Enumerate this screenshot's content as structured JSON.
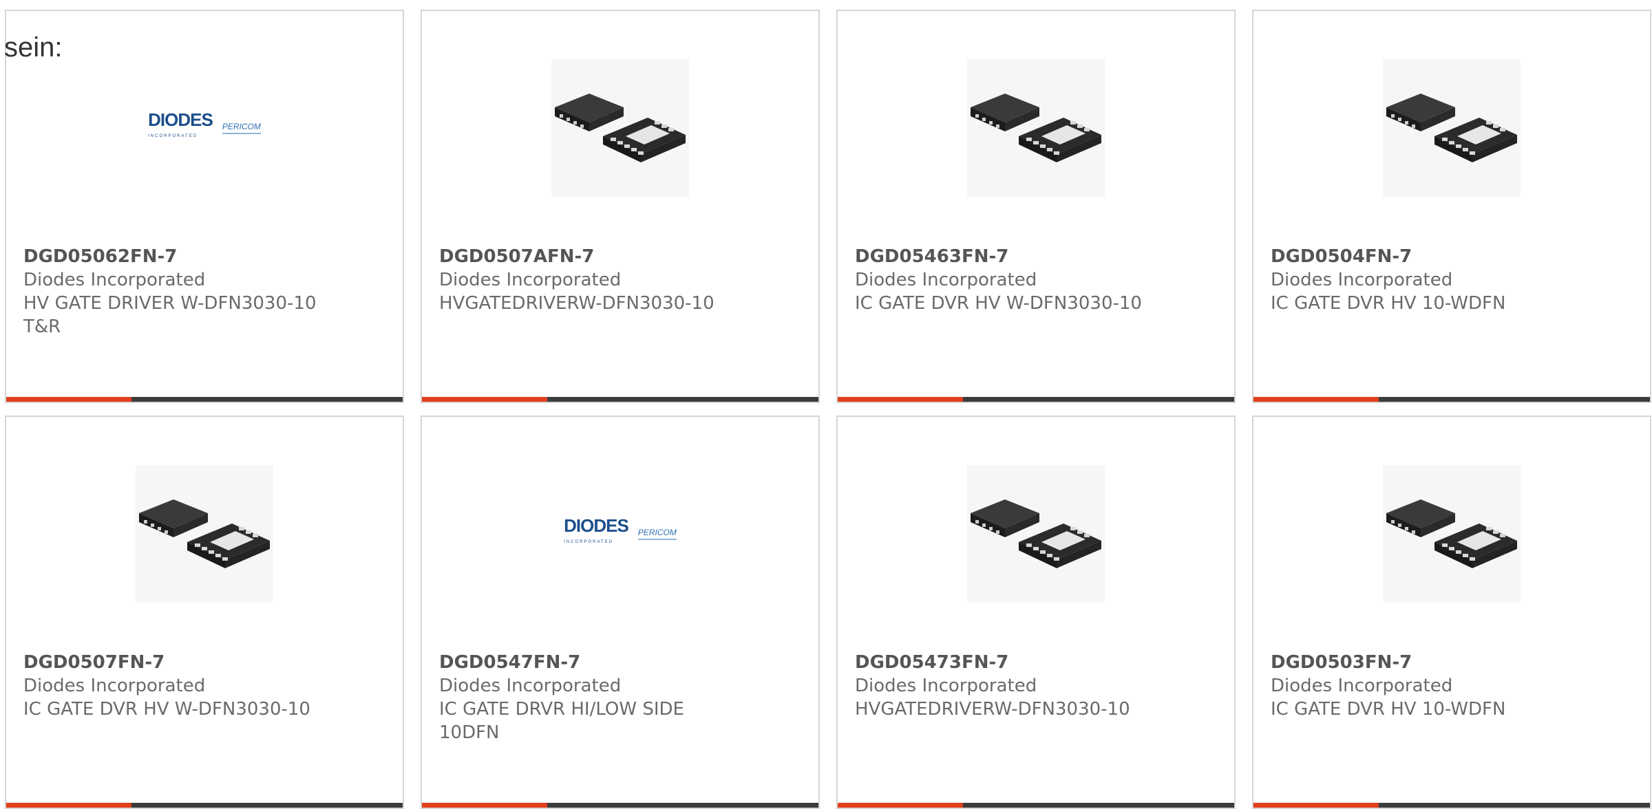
{
  "intro_text": "sein:",
  "icons": {
    "chip": "ic-chip-package-image",
    "logo": "diodes-pericom-logo"
  },
  "colors": {
    "accent": "#e0401c",
    "bar": "#3c3c3c",
    "border": "#d5d5d5"
  },
  "products": [
    {
      "part": "DGD05062FN-7",
      "maker": "Diodes Incorporated",
      "desc": "HV GATE DRIVER W-DFN3030-10 T&R",
      "image": "logo",
      "logo_main": "DIODES",
      "logo_sub": "INCORPORATED",
      "logo_side": "PERICOM"
    },
    {
      "part": "DGD0507AFN-7",
      "maker": "Diodes Incorporated",
      "desc": "HVGATEDRIVERW-DFN3030-10",
      "image": "chip"
    },
    {
      "part": "DGD05463FN-7",
      "maker": "Diodes Incorporated",
      "desc": "IC GATE DVR HV W-DFN3030-10",
      "image": "chip"
    },
    {
      "part": "DGD0504FN-7",
      "maker": "Diodes Incorporated",
      "desc": "IC GATE DVR HV 10-WDFN",
      "image": "chip"
    },
    {
      "part": "DGD0507FN-7",
      "maker": "Diodes Incorporated",
      "desc": "IC GATE DVR HV W-DFN3030-10",
      "image": "chip"
    },
    {
      "part": "DGD0547FN-7",
      "maker": "Diodes Incorporated",
      "desc": "IC GATE DRVR HI/LOW SIDE 10DFN",
      "image": "logo",
      "logo_main": "DIODES",
      "logo_sub": "INCORPORATED",
      "logo_side": "PERICOM"
    },
    {
      "part": "DGD05473FN-7",
      "maker": "Diodes Incorporated",
      "desc": "HVGATEDRIVERW-DFN3030-10",
      "image": "chip"
    },
    {
      "part": "DGD0503FN-7",
      "maker": "Diodes Incorporated",
      "desc": "IC GATE DVR HV 10-WDFN",
      "image": "chip"
    }
  ]
}
